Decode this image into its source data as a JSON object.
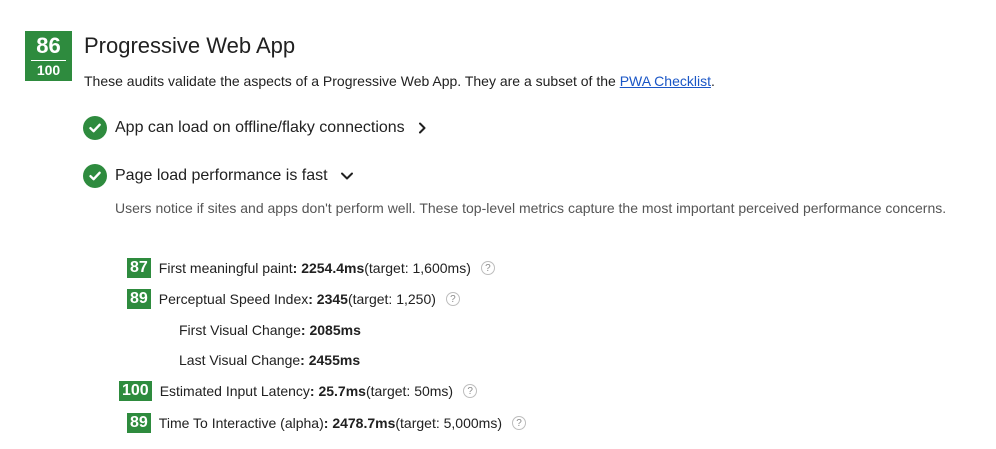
{
  "category": {
    "score": "86",
    "max": "100",
    "title": "Progressive Web App",
    "description_prefix": "These audits validate the aspects of a Progressive Web App. They are a subset of the ",
    "checklist_link": "PWA Checklist",
    "description_suffix": "."
  },
  "audits": [
    {
      "label": "App can load on offline/flaky connections",
      "expanded": false,
      "icon": "chevron-right-icon"
    },
    {
      "label": "Page load performance is fast",
      "expanded": true,
      "icon": "chevron-down-icon"
    }
  ],
  "help_text": "Users notice if sites and apps don't perform well. These top-level metrics capture the most important perceived performance concerns.",
  "metrics": [
    {
      "score": "87",
      "name": "First meaningful paint",
      "value": ": 2254.4ms",
      "target": " (target: 1,600ms)"
    },
    {
      "score": "89",
      "name": "Perceptual Speed Index",
      "value": ": 2345",
      "target": " (target: 1,250)"
    },
    {
      "score": "100",
      "name": "Estimated Input Latency",
      "value": ": 25.7ms",
      "target": " (target: 50ms)"
    },
    {
      "score": "89",
      "name": "Time To Interactive (alpha)",
      "value": ": 2478.7ms",
      "target": " (target: 5,000ms)"
    }
  ],
  "sub_metrics": [
    {
      "name": "First Visual Change",
      "value": ": 2085ms"
    },
    {
      "name": "Last Visual Change",
      "value": ": 2455ms"
    }
  ],
  "help_glyph": "?",
  "colors": {
    "pass": "#2e8b3e",
    "link": "#1a56c6"
  }
}
